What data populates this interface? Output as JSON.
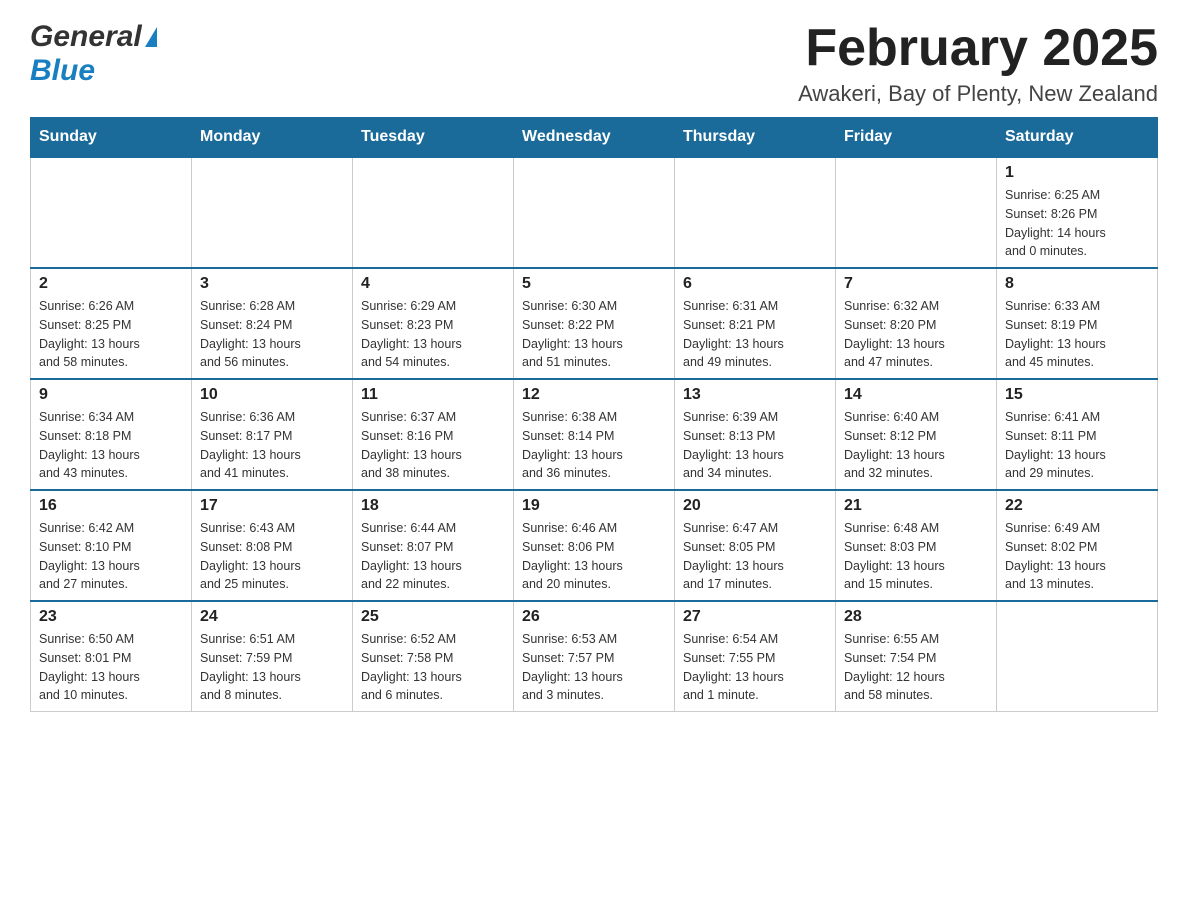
{
  "header": {
    "logo_general": "General",
    "logo_blue": "Blue",
    "month_title": "February 2025",
    "location": "Awakeri, Bay of Plenty, New Zealand"
  },
  "calendar": {
    "days_of_week": [
      "Sunday",
      "Monday",
      "Tuesday",
      "Wednesday",
      "Thursday",
      "Friday",
      "Saturday"
    ],
    "weeks": [
      [
        {
          "day": "",
          "info": ""
        },
        {
          "day": "",
          "info": ""
        },
        {
          "day": "",
          "info": ""
        },
        {
          "day": "",
          "info": ""
        },
        {
          "day": "",
          "info": ""
        },
        {
          "day": "",
          "info": ""
        },
        {
          "day": "1",
          "info": "Sunrise: 6:25 AM\nSunset: 8:26 PM\nDaylight: 14 hours\nand 0 minutes."
        }
      ],
      [
        {
          "day": "2",
          "info": "Sunrise: 6:26 AM\nSunset: 8:25 PM\nDaylight: 13 hours\nand 58 minutes."
        },
        {
          "day": "3",
          "info": "Sunrise: 6:28 AM\nSunset: 8:24 PM\nDaylight: 13 hours\nand 56 minutes."
        },
        {
          "day": "4",
          "info": "Sunrise: 6:29 AM\nSunset: 8:23 PM\nDaylight: 13 hours\nand 54 minutes."
        },
        {
          "day": "5",
          "info": "Sunrise: 6:30 AM\nSunset: 8:22 PM\nDaylight: 13 hours\nand 51 minutes."
        },
        {
          "day": "6",
          "info": "Sunrise: 6:31 AM\nSunset: 8:21 PM\nDaylight: 13 hours\nand 49 minutes."
        },
        {
          "day": "7",
          "info": "Sunrise: 6:32 AM\nSunset: 8:20 PM\nDaylight: 13 hours\nand 47 minutes."
        },
        {
          "day": "8",
          "info": "Sunrise: 6:33 AM\nSunset: 8:19 PM\nDaylight: 13 hours\nand 45 minutes."
        }
      ],
      [
        {
          "day": "9",
          "info": "Sunrise: 6:34 AM\nSunset: 8:18 PM\nDaylight: 13 hours\nand 43 minutes."
        },
        {
          "day": "10",
          "info": "Sunrise: 6:36 AM\nSunset: 8:17 PM\nDaylight: 13 hours\nand 41 minutes."
        },
        {
          "day": "11",
          "info": "Sunrise: 6:37 AM\nSunset: 8:16 PM\nDaylight: 13 hours\nand 38 minutes."
        },
        {
          "day": "12",
          "info": "Sunrise: 6:38 AM\nSunset: 8:14 PM\nDaylight: 13 hours\nand 36 minutes."
        },
        {
          "day": "13",
          "info": "Sunrise: 6:39 AM\nSunset: 8:13 PM\nDaylight: 13 hours\nand 34 minutes."
        },
        {
          "day": "14",
          "info": "Sunrise: 6:40 AM\nSunset: 8:12 PM\nDaylight: 13 hours\nand 32 minutes."
        },
        {
          "day": "15",
          "info": "Sunrise: 6:41 AM\nSunset: 8:11 PM\nDaylight: 13 hours\nand 29 minutes."
        }
      ],
      [
        {
          "day": "16",
          "info": "Sunrise: 6:42 AM\nSunset: 8:10 PM\nDaylight: 13 hours\nand 27 minutes."
        },
        {
          "day": "17",
          "info": "Sunrise: 6:43 AM\nSunset: 8:08 PM\nDaylight: 13 hours\nand 25 minutes."
        },
        {
          "day": "18",
          "info": "Sunrise: 6:44 AM\nSunset: 8:07 PM\nDaylight: 13 hours\nand 22 minutes."
        },
        {
          "day": "19",
          "info": "Sunrise: 6:46 AM\nSunset: 8:06 PM\nDaylight: 13 hours\nand 20 minutes."
        },
        {
          "day": "20",
          "info": "Sunrise: 6:47 AM\nSunset: 8:05 PM\nDaylight: 13 hours\nand 17 minutes."
        },
        {
          "day": "21",
          "info": "Sunrise: 6:48 AM\nSunset: 8:03 PM\nDaylight: 13 hours\nand 15 minutes."
        },
        {
          "day": "22",
          "info": "Sunrise: 6:49 AM\nSunset: 8:02 PM\nDaylight: 13 hours\nand 13 minutes."
        }
      ],
      [
        {
          "day": "23",
          "info": "Sunrise: 6:50 AM\nSunset: 8:01 PM\nDaylight: 13 hours\nand 10 minutes."
        },
        {
          "day": "24",
          "info": "Sunrise: 6:51 AM\nSunset: 7:59 PM\nDaylight: 13 hours\nand 8 minutes."
        },
        {
          "day": "25",
          "info": "Sunrise: 6:52 AM\nSunset: 7:58 PM\nDaylight: 13 hours\nand 6 minutes."
        },
        {
          "day": "26",
          "info": "Sunrise: 6:53 AM\nSunset: 7:57 PM\nDaylight: 13 hours\nand 3 minutes."
        },
        {
          "day": "27",
          "info": "Sunrise: 6:54 AM\nSunset: 7:55 PM\nDaylight: 13 hours\nand 1 minute."
        },
        {
          "day": "28",
          "info": "Sunrise: 6:55 AM\nSunset: 7:54 PM\nDaylight: 12 hours\nand 58 minutes."
        },
        {
          "day": "",
          "info": ""
        }
      ]
    ]
  }
}
